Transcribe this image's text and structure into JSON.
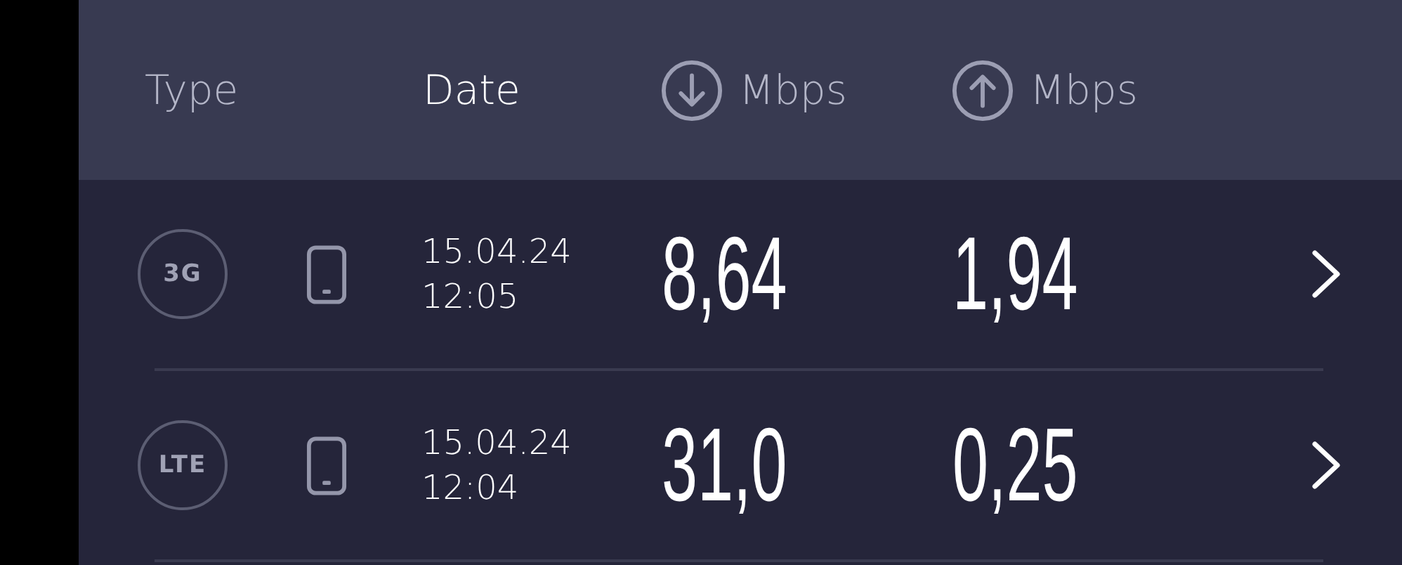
{
  "header": {
    "columns": [
      {
        "kind": "text",
        "label": "Type",
        "selected": false
      },
      {
        "kind": "text",
        "label": "Date",
        "selected": true
      },
      {
        "kind": "download",
        "label": "Mbps",
        "selected": false
      },
      {
        "kind": "upload",
        "label": "Mbps",
        "selected": false
      }
    ]
  },
  "rows": [
    {
      "network": "3G",
      "date": "15.04.24",
      "time": "12:05",
      "download": "8,64",
      "upload": "1,94"
    },
    {
      "network": "LTE",
      "date": "15.04.24",
      "time": "12:04",
      "download": "31,0",
      "upload": "0,25"
    }
  ]
}
